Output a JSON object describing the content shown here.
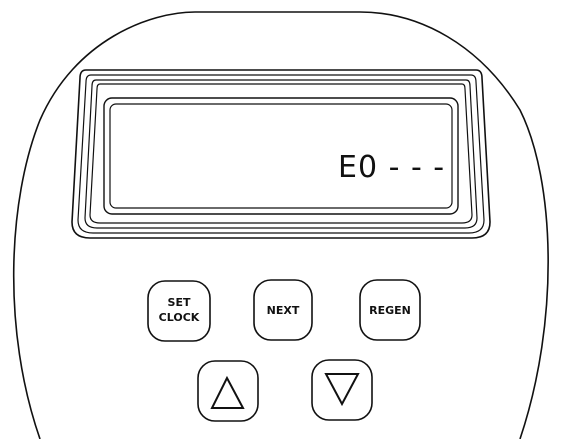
{
  "display": {
    "readout": "E0 - - -"
  },
  "buttons": {
    "set_clock": {
      "line1": "SET",
      "line2": "CLOCK"
    },
    "next": {
      "label": "NEXT"
    },
    "regen": {
      "label": "REGEN"
    },
    "up": {
      "icon": "up-triangle-icon"
    },
    "down": {
      "icon": "down-triangle-icon"
    }
  },
  "colors": {
    "stroke": "#111111",
    "background": "#ffffff"
  }
}
